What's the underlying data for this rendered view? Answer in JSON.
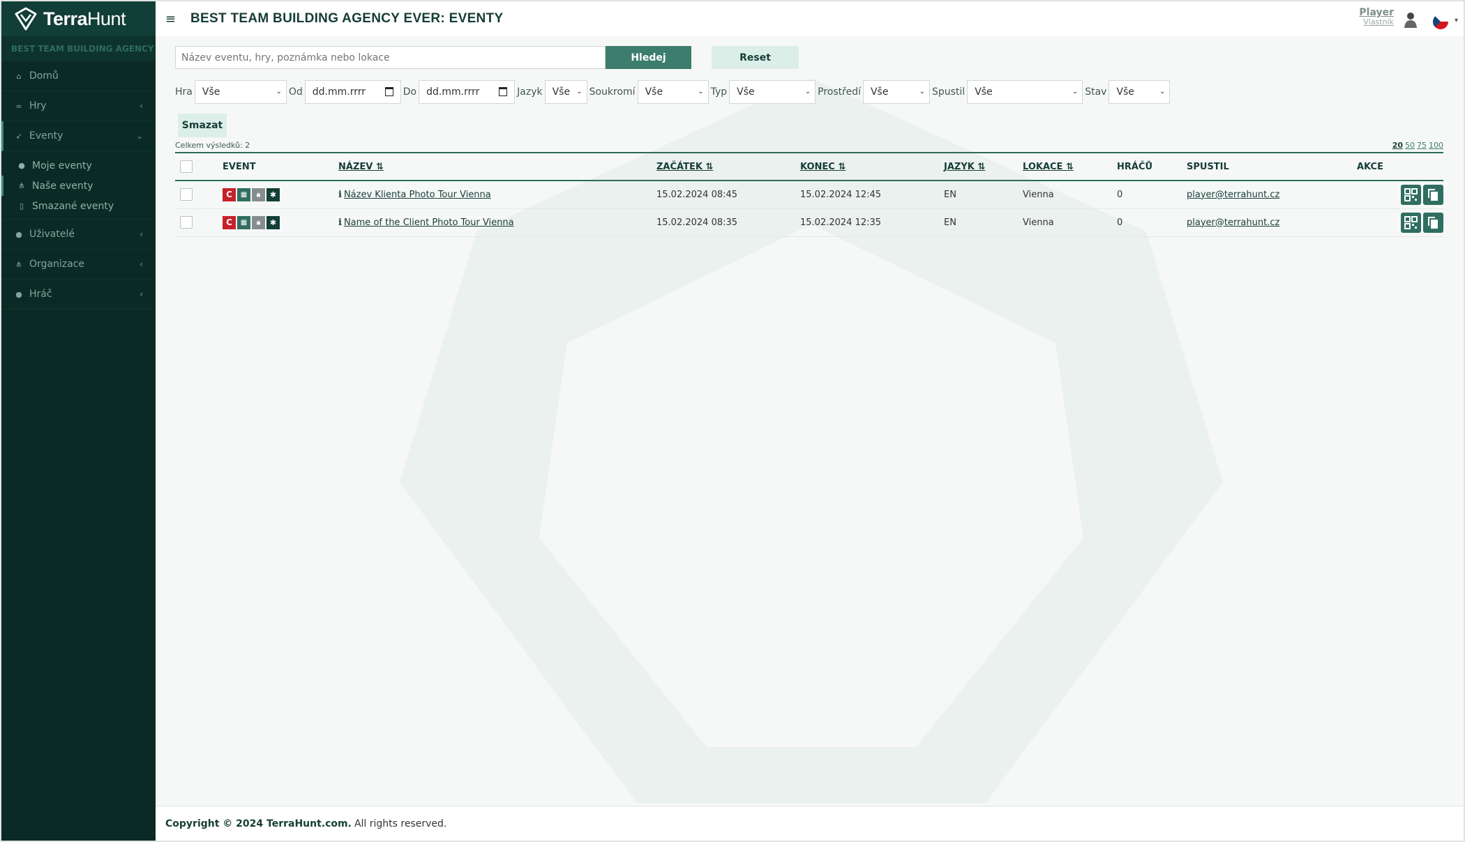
{
  "brand": {
    "name_bold": "Terra",
    "name_rest": "Hunt"
  },
  "sidebar": {
    "agency": "BEST TEAM BUILDING AGENCY EVER",
    "items": [
      {
        "label": "Domů",
        "icon": "home-icon"
      },
      {
        "label": "Hry",
        "icon": "gamepad-icon"
      },
      {
        "label": "Eventy",
        "icon": "rocket-icon"
      },
      {
        "label": "Uživatelé",
        "icon": "users-icon"
      },
      {
        "label": "Organizace",
        "icon": "sitemap-icon"
      },
      {
        "label": "Hráč",
        "icon": "user-icon"
      }
    ],
    "sub_items": [
      {
        "label": "Moje eventy",
        "icon": "user-icon"
      },
      {
        "label": "Naše eventy",
        "icon": "sitemap-icon"
      },
      {
        "label": "Smazané eventy",
        "icon": "trash-icon"
      }
    ]
  },
  "header": {
    "title": "BEST TEAM BUILDING AGENCY EVER: EVENTY",
    "user_name": "Player",
    "user_role": "Vlastník"
  },
  "search": {
    "placeholder": "Název eventu, hry, poznámka nebo lokace",
    "search_label": "Hledej",
    "reset_label": "Reset"
  },
  "filters": {
    "hra": {
      "label": "Hra",
      "value": "Vše"
    },
    "od": {
      "label": "Od",
      "value": "dd.mm.rrrr"
    },
    "do": {
      "label": "Do",
      "value": "dd.mm.rrrr"
    },
    "jazyk": {
      "label": "Jazyk",
      "value": "Vše"
    },
    "soukromi": {
      "label": "Soukromí",
      "value": "Vše"
    },
    "typ": {
      "label": "Typ",
      "value": "Vše"
    },
    "prostredi": {
      "label": "Prostředí",
      "value": "Vše"
    },
    "spustil": {
      "label": "Spustil",
      "value": "Vše"
    },
    "stav": {
      "label": "Stav",
      "value": "Vše"
    }
  },
  "delete_label": "Smazat",
  "results": {
    "text": "Celkem výsledků: 2",
    "per_page": [
      "20",
      "50",
      "75",
      "100"
    ]
  },
  "table": {
    "headers": {
      "event": "EVENT",
      "nazev": "NÁZEV ⇅",
      "zacatek": "ZAČÁTEK ⇅",
      "konec": "KONEC ⇅",
      "jazyk": "JAZYK ⇅",
      "lokace": "LOKACE ⇅",
      "hracu": "HRÁČŮ",
      "spustil": "SPUSTIL",
      "akce": "AKCE"
    },
    "rows": [
      {
        "badge_c": "C",
        "name": "Název Klienta Photo Tour Vienna",
        "start": "15.02.2024 08:45",
        "end": "15.02.2024 12:45",
        "lang": "EN",
        "location": "Vienna",
        "players": "0",
        "started_by": "player@terrahunt.cz"
      },
      {
        "badge_c": "C",
        "name": "Name of the Client Photo Tour Vienna",
        "start": "15.02.2024 08:35",
        "end": "15.02.2024 12:35",
        "lang": "EN",
        "location": "Vienna",
        "players": "0",
        "started_by": "player@terrahunt.cz"
      }
    ]
  },
  "footer": {
    "copyright": "Copyright © 2024 TerraHunt.com.",
    "rights": "All rights reserved."
  },
  "colors": {
    "sidebar": "#0c2a25",
    "accent": "#3c7d6d",
    "badge_red": "#c8202a",
    "badge_dark": "#123f36"
  }
}
